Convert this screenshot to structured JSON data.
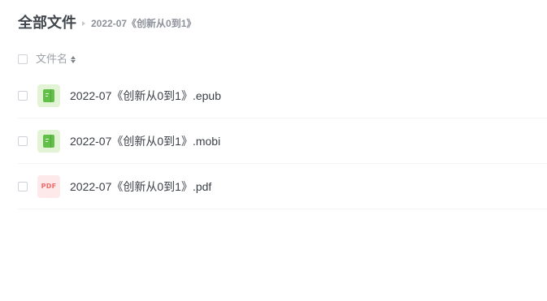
{
  "breadcrumb": {
    "root": "全部文件",
    "current": "2022-07《创新从0到1》"
  },
  "list_header": {
    "name_column": "文件名"
  },
  "files": [
    {
      "name": "2022-07《创新从0到1》.epub",
      "icon": "ebook-icon"
    },
    {
      "name": "2022-07《创新从0到1》.mobi",
      "icon": "ebook-icon"
    },
    {
      "name": "2022-07《创新从0到1》.pdf",
      "icon": "pdf-file-icon",
      "icon_text": "PDF"
    }
  ],
  "colors": {
    "ebook_icon": "#62bf4a",
    "ebook_icon_bg": "#e3f4d6",
    "pdf_icon": "#f26b6b",
    "pdf_icon_bg": "#fde9e9"
  }
}
